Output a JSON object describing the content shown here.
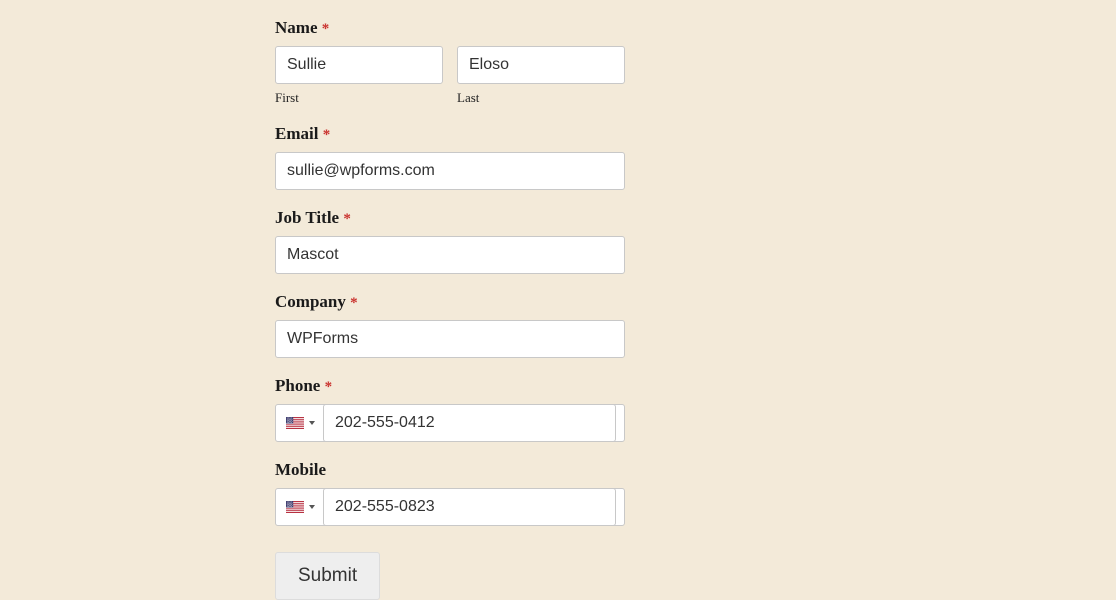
{
  "form": {
    "name": {
      "label": "Name",
      "required": true,
      "first": {
        "value": "Sullie",
        "sublabel": "First"
      },
      "last": {
        "value": "Eloso",
        "sublabel": "Last"
      }
    },
    "email": {
      "label": "Email",
      "required": true,
      "value": "sullie@wpforms.com"
    },
    "job_title": {
      "label": "Job Title",
      "required": true,
      "value": "Mascot"
    },
    "company": {
      "label": "Company",
      "required": true,
      "value": "WPForms"
    },
    "phone": {
      "label": "Phone",
      "required": true,
      "value": "202-555-0412",
      "country": "US"
    },
    "mobile": {
      "label": "Mobile",
      "required": false,
      "value": "202-555-0823",
      "country": "US"
    },
    "submit_label": "Submit",
    "required_marker": "*"
  }
}
